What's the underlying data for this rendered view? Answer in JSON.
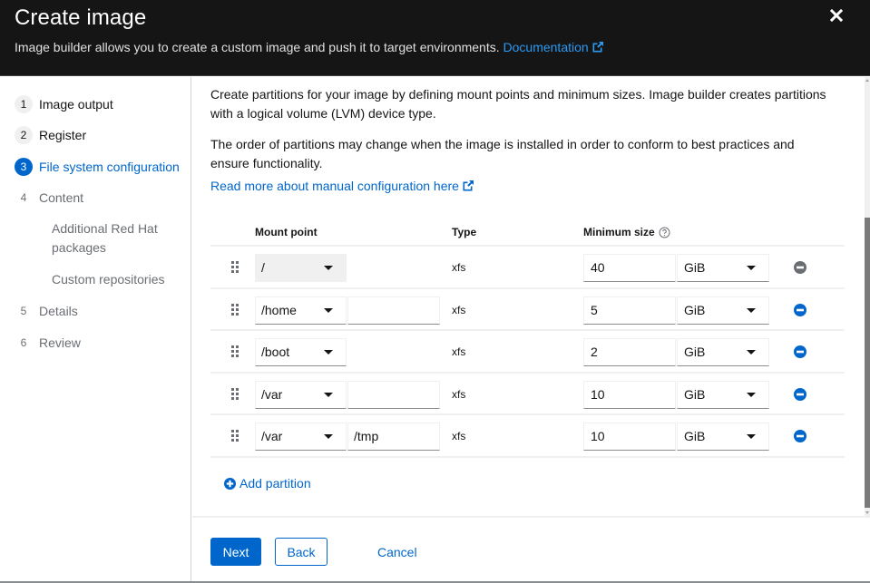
{
  "header": {
    "title": "Create image",
    "description": "Image builder allows you to create a custom image and push it to target environments.",
    "documentation_link": "Documentation",
    "close_icon": "close-icon"
  },
  "nav": {
    "steps": [
      {
        "number": "1",
        "label": "Image output",
        "state": "done"
      },
      {
        "number": "2",
        "label": "Register",
        "state": "done"
      },
      {
        "number": "3",
        "label": "File system configuration",
        "state": "current"
      },
      {
        "number": "4",
        "label": "Content",
        "state": "pending"
      },
      {
        "number": "5",
        "label": "Details",
        "state": "pending"
      },
      {
        "number": "6",
        "label": "Review",
        "state": "pending"
      }
    ],
    "substeps": [
      {
        "label": "Additional Red Hat packages"
      },
      {
        "label": "Custom repositories"
      }
    ]
  },
  "main": {
    "intro": "Create partitions for your image by defining mount points and minimum sizes. Image builder creates partitions with a logical volume (LVM) device type.",
    "order_note": "The order of partitions may change when the image is installed in order to conform to best practices and ensure functionality.",
    "read_more_link": "Read more about manual configuration here",
    "table": {
      "headers": {
        "mount_point": "Mount point",
        "type": "Type",
        "minimum_size": "Minimum size"
      },
      "rows": [
        {
          "mount_point": "/",
          "suffix": null,
          "type": "xfs",
          "size": "40",
          "unit": "GiB",
          "removable": false
        },
        {
          "mount_point": "/home",
          "suffix": "",
          "type": "xfs",
          "size": "5",
          "unit": "GiB",
          "removable": true
        },
        {
          "mount_point": "/boot",
          "suffix": null,
          "type": "xfs",
          "size": "2",
          "unit": "GiB",
          "removable": true
        },
        {
          "mount_point": "/var",
          "suffix": "",
          "type": "xfs",
          "size": "10",
          "unit": "GiB",
          "removable": true
        },
        {
          "mount_point": "/var",
          "suffix": "/tmp",
          "type": "xfs",
          "size": "10",
          "unit": "GiB",
          "removable": true
        }
      ]
    },
    "add_partition_label": "Add partition"
  },
  "footer": {
    "next_label": "Next",
    "back_label": "Back",
    "cancel_label": "Cancel"
  },
  "colors": {
    "primary": "#0066cc",
    "header_bg": "#151515",
    "link_on_dark": "#2b9af3",
    "disabled_icon": "#6a6e73"
  }
}
